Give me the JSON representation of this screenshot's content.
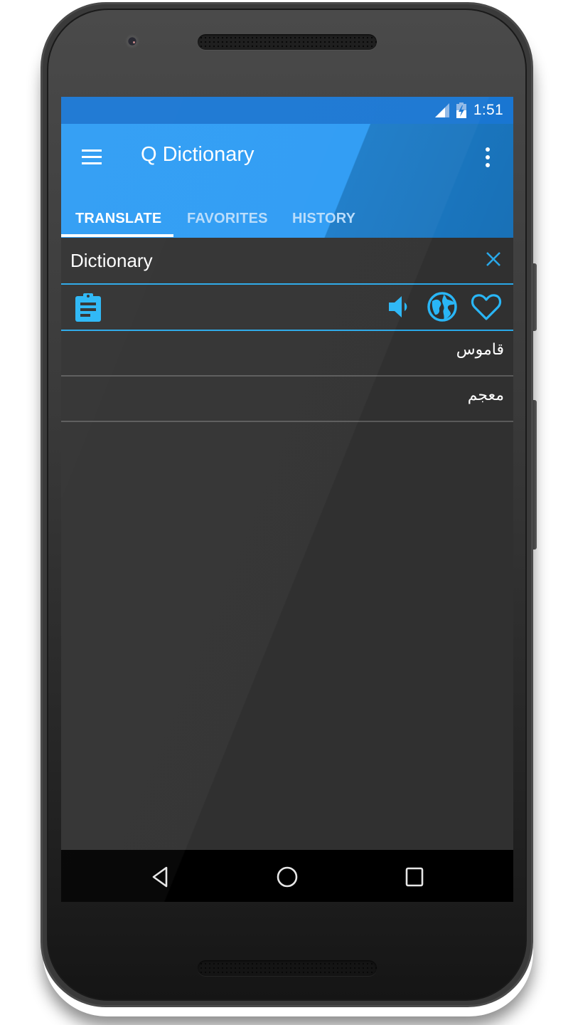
{
  "status_bar": {
    "time": "1:51",
    "icons": [
      "signal-icon",
      "battery-charging-icon"
    ]
  },
  "app_bar": {
    "title": "Q Dictionary",
    "menu_icon": "hamburger-menu-icon",
    "overflow_icon": "more-vertical-icon"
  },
  "tabs": [
    {
      "label": "TRANSLATE",
      "active": true
    },
    {
      "label": "FAVORITES",
      "active": false
    },
    {
      "label": "HISTORY",
      "active": false
    }
  ],
  "search": {
    "value": "Dictionary",
    "clear_icon": "close-icon"
  },
  "actions": {
    "paste_icon": "clipboard-icon",
    "speak_icon": "volume-icon",
    "language_icon": "globe-icon",
    "favorite_icon": "heart-outline-icon"
  },
  "results": [
    {
      "text": "قاموس"
    },
    {
      "text": "معجم"
    }
  ],
  "nav_bar": {
    "back_icon": "back-triangle-icon",
    "home_icon": "home-circle-icon",
    "recents_icon": "recents-square-icon"
  },
  "colors": {
    "app_bar": "#2196f3",
    "status_bar": "#1976d2",
    "accent": "#29b6f6",
    "background": "#303030"
  }
}
